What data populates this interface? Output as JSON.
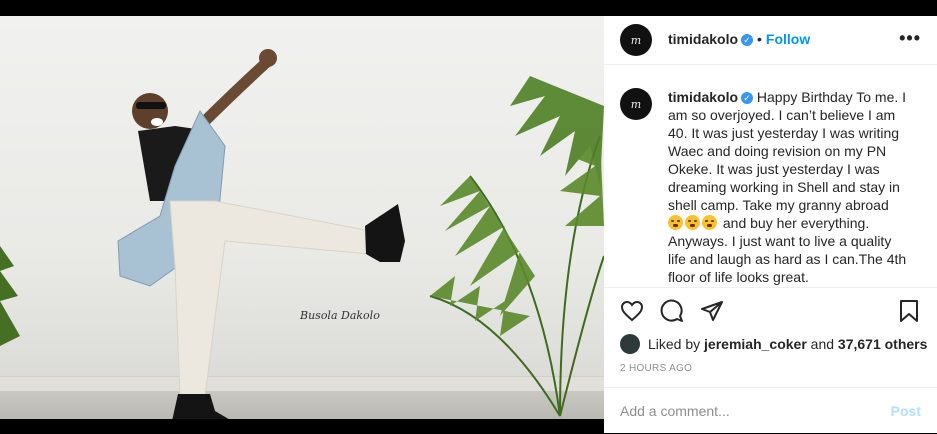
{
  "post": {
    "username": "timidakolo",
    "follow_label": "Follow",
    "dot": "•",
    "more_label": "•••",
    "avatar_text": "m",
    "watermark": "Busola Dakolo",
    "caption_lines": [
      "Happy Birthday To me. I",
      "am so overjoyed. I can’t believe I am",
      "40. It was just yesterday I was writing",
      "Waec and doing revision on my PN",
      "Okeke. It was just yesterday I was",
      "dreaming working in Shell and stay in",
      "shell camp. Take my granny abroad",
      " and buy her everything.",
      "Anyways. I just want to live a quality",
      "life and laugh as hard as I can.The 4th",
      "floor of life looks great."
    ],
    "likes_prefix": "Liked by",
    "likes_user": "jeremiah_coker",
    "likes_and": "and",
    "likes_count": "37,671 others",
    "timestamp": "2 HOURS AGO",
    "comment_placeholder": "Add a comment...",
    "post_label": "Post"
  },
  "icons": [
    "heart-icon",
    "comment-icon",
    "share-icon",
    "bookmark-icon",
    "verified-icon",
    "more-icon"
  ],
  "colors": {
    "accent": "#0095f6",
    "verified": "#3897f0",
    "muted": "#8e8e8e",
    "post_disabled": "#b2dffc"
  }
}
